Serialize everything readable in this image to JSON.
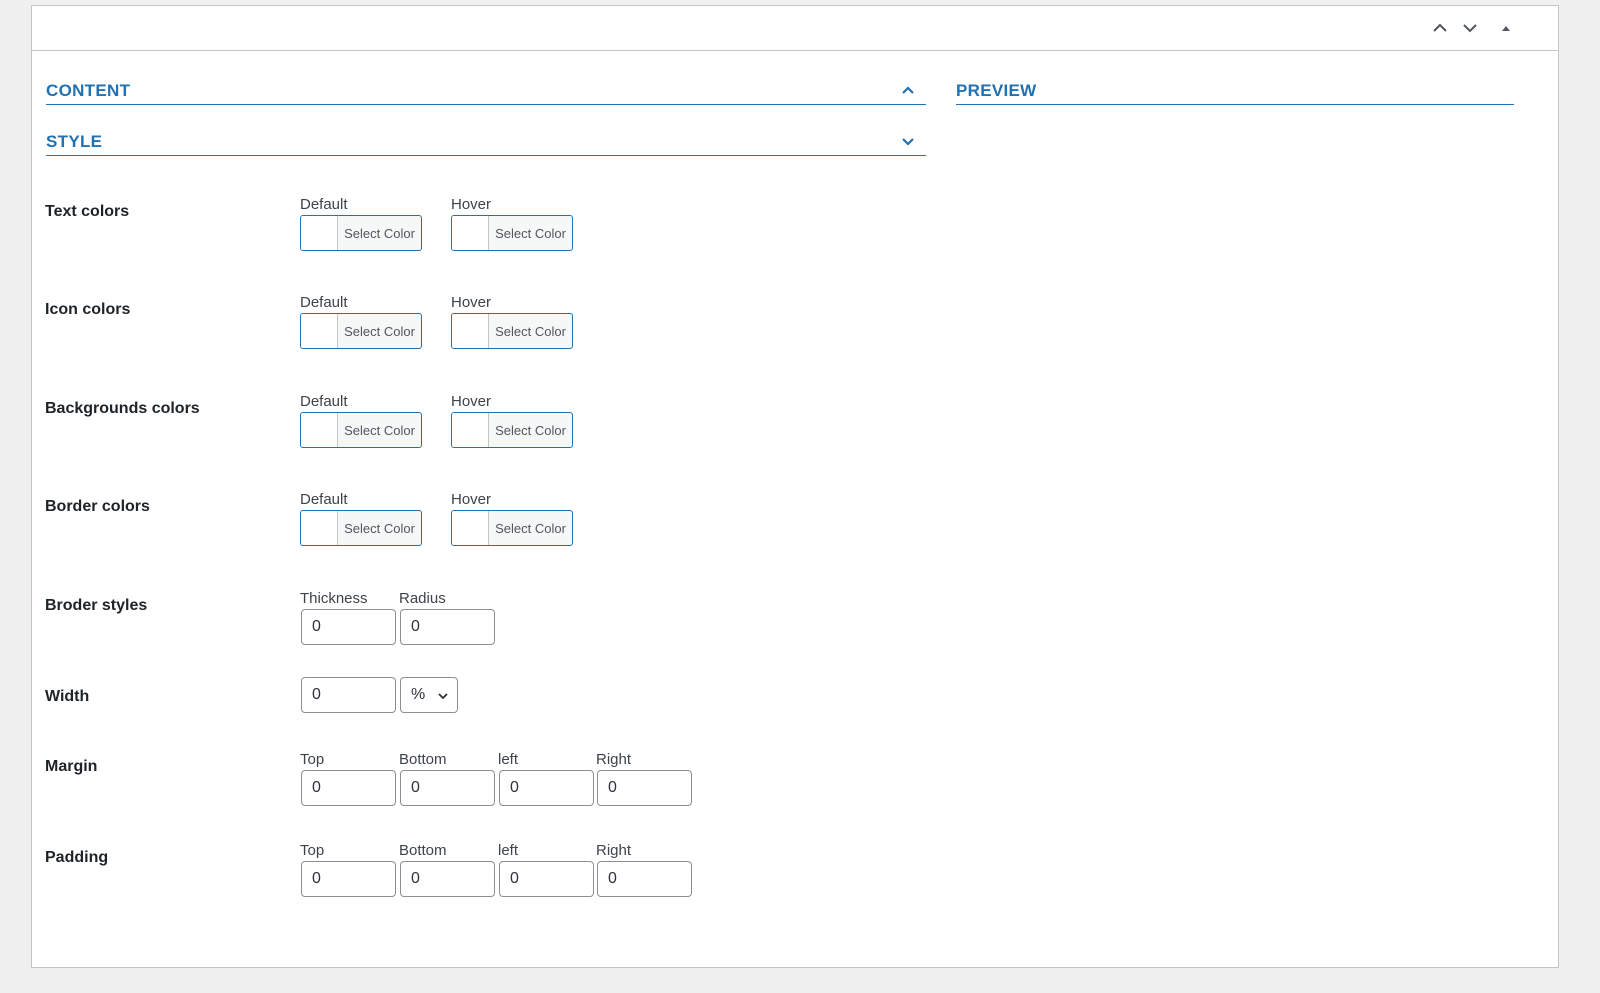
{
  "sections": {
    "content": "CONTENT",
    "style": "STYLE",
    "preview": "PREVIEW"
  },
  "select_color_label": "Select Color",
  "default_label": "Default",
  "hover_label": "Hover",
  "rows": {
    "text_colors": "Text colors",
    "icon_colors": "Icon colors",
    "background_colors": "Backgrounds colors",
    "border_colors": "Border colors",
    "border_styles": "Broder styles",
    "width": "Width",
    "margin": "Margin",
    "padding": "Padding"
  },
  "border_styles": {
    "thickness_label": "Thickness",
    "radius_label": "Radius",
    "thickness": "0",
    "radius": "0"
  },
  "width": {
    "value": "0",
    "unit": "%"
  },
  "spacing_labels": {
    "top": "Top",
    "bottom": "Bottom",
    "left": "left",
    "right": "Right"
  },
  "margin": {
    "top": "0",
    "bottom": "0",
    "left": "0",
    "right": "0"
  },
  "padding": {
    "top": "0",
    "bottom": "0",
    "left": "0",
    "right": "0"
  },
  "colors": {
    "accent": "#2271b1",
    "background": "#f0f0f1"
  },
  "icons": [
    "arrow-up-icon",
    "arrow-down-icon",
    "collapse-triangle-icon",
    "chevron-up-icon",
    "chevron-down-icon"
  ]
}
